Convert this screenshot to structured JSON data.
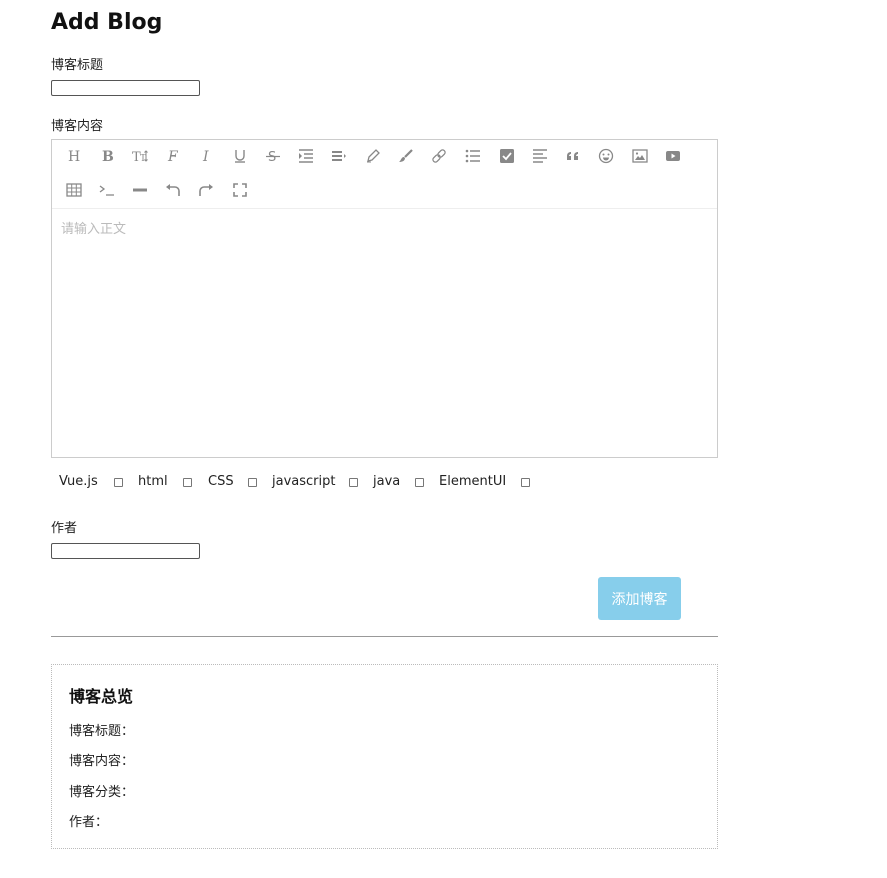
{
  "page": {
    "title": "Add Blog"
  },
  "form": {
    "title_label": "博客标题",
    "title_value": "",
    "content_label": "博客内容",
    "content_placeholder": "请输入正文",
    "author_label": "作者",
    "author_value": "",
    "submit_label": "添加博客"
  },
  "toolbar": {
    "items": [
      {
        "icon": "heading-icon"
      },
      {
        "icon": "bold-icon"
      },
      {
        "icon": "font-size-icon"
      },
      {
        "icon": "font-family-icon"
      },
      {
        "icon": "italic-icon"
      },
      {
        "icon": "underline-icon"
      },
      {
        "icon": "strikethrough-icon"
      },
      {
        "icon": "indent-icon"
      },
      {
        "icon": "line-height-icon"
      },
      {
        "icon": "pen-color-icon"
      },
      {
        "icon": "brush-bg-color-icon"
      },
      {
        "icon": "link-icon"
      },
      {
        "icon": "bullet-list-icon"
      },
      {
        "icon": "checkbox-todo-icon"
      },
      {
        "icon": "align-left-icon"
      },
      {
        "icon": "quote-icon"
      },
      {
        "icon": "emoji-icon"
      },
      {
        "icon": "image-icon"
      },
      {
        "icon": "video-icon"
      },
      {
        "icon": "table-icon"
      },
      {
        "icon": "code-icon"
      },
      {
        "icon": "divider-icon"
      },
      {
        "icon": "undo-icon"
      },
      {
        "icon": "redo-icon"
      },
      {
        "icon": "fullscreen-icon"
      }
    ]
  },
  "categories": [
    {
      "label": "Vue.js",
      "checked": false
    },
    {
      "label": "html",
      "checked": false
    },
    {
      "label": "CSS",
      "checked": false
    },
    {
      "label": "javascript",
      "checked": false
    },
    {
      "label": "java",
      "checked": false
    },
    {
      "label": "ElementUI",
      "checked": false
    }
  ],
  "preview": {
    "heading": "博客总览",
    "title_line": "博客标题：",
    "content_line": "博客内容：",
    "category_line": "博客分类：",
    "author_line": "作者："
  },
  "colors": {
    "submit_bg": "#87ceeb",
    "icon": "#888888"
  }
}
